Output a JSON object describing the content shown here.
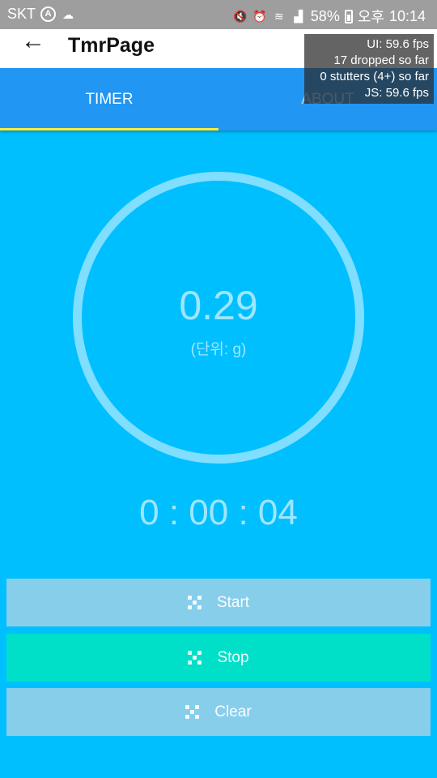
{
  "status_bar": {
    "carrier": "SKT",
    "battery": "58%",
    "ampm": "오후",
    "time": "10:14",
    "icons": [
      "a-icon",
      "cloud-icon",
      "mute-icon",
      "alarm-icon",
      "wifi-icon",
      "signal-icon",
      "battery-icon"
    ]
  },
  "header": {
    "back_icon": "←",
    "title": "TmrPage"
  },
  "tabs": [
    {
      "label": "TIMER",
      "active": true
    },
    {
      "label": "ABOUT",
      "active": false
    }
  ],
  "perf_monitor": {
    "ui_fps": "UI: 59.6 fps",
    "dropped": "17 dropped so far",
    "stutters": "0 stutters (4+) so far",
    "js_fps": "JS: 59.6 fps"
  },
  "gauge": {
    "value": "0.29",
    "unit": "(단위: g)"
  },
  "timer": {
    "display": "0 : 00 : 04"
  },
  "buttons": {
    "start": "Start",
    "stop": "Stop",
    "clear": "Clear"
  },
  "colors": {
    "background": "#00bfff",
    "tab_bar": "#2196f3",
    "tab_indicator": "#ffeb3b",
    "ring": "#80deff",
    "start_clear_button": "#87ceeb",
    "stop_button": "#00e0c8"
  }
}
